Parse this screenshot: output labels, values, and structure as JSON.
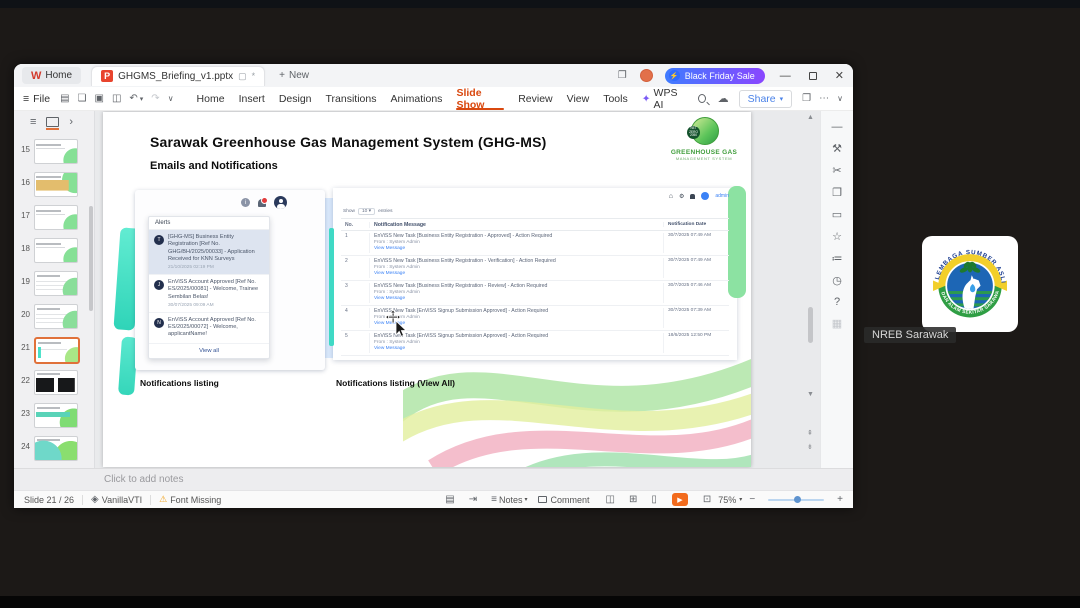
{
  "titlebar": {
    "home_tab": "Home",
    "doc_tab": "GHGMS_Briefing_v1.pptx",
    "doc_modified": "*",
    "new_tab": "New",
    "promo": "Black Friday Sale"
  },
  "menubar": {
    "file": "File",
    "items": [
      "Home",
      "Insert",
      "Design",
      "Transitions",
      "Animations",
      "Slide Show",
      "Review",
      "View",
      "Tools",
      "WPS AI"
    ],
    "share": "Share"
  },
  "icons": {
    "burger": "≡",
    "save": "▤",
    "export": "❏",
    "print": "▣",
    "preview": "◫",
    "undo": "↶",
    "redo": "↷",
    "caret_down": "▾",
    "chevron_down": "∨",
    "sparkle": "✦",
    "cloud": "☁",
    "panel": "❐",
    "ellipsis": "⋯",
    "window_stack": "❐",
    "minimize": "—",
    "close": "✕",
    "lightning": "⚡",
    "plus": "+",
    "chevron_right": "›",
    "scroll_up": "▲",
    "scroll_down": "▼",
    "page_up": "⇞",
    "page_down": "⇟",
    "home": "⌂",
    "gear": "⚙",
    "warning": "⚠",
    "theme": "◈",
    "doc": "▤",
    "goto": "⇥",
    "play": "▶",
    "fit": "⊡",
    "minus": "−",
    "view_normal": "◫",
    "view_sorter": "⊞",
    "view_read": "▯",
    "toolbar_right": [
      "—",
      "⚒",
      "✂",
      "❐",
      "▭",
      "☆",
      "≔",
      "◷",
      "?",
      "▦"
    ]
  },
  "sidebar": {
    "numbers": [
      "15",
      "16",
      "17",
      "18",
      "19",
      "20",
      "21",
      "22",
      "23",
      "24"
    ],
    "selected": "21"
  },
  "slide": {
    "title": "Sarawak Greenhouse Gas Management System (GHG-MS)",
    "subtitle": "Emails and Notifications",
    "logo": {
      "badge": "NET ZERO 2050",
      "line1": "GREENHOUSE GAS",
      "line2": "MANAGEMENT SYSTEM"
    },
    "captions": {
      "left": "Notifications listing",
      "right": "Notifications listing (View All)"
    },
    "alerts": {
      "header": "Alerts",
      "view_all": "View all",
      "items": [
        {
          "initial": "T",
          "text": "[GHG-MS] Business Entity Registration [Ref No. GHG/BH/2025/00033] - Application Received for KNN Surveys",
          "time": "21/10/2025 02:19 PM"
        },
        {
          "initial": "J",
          "text": "EnViSS Account Approved [Ref No. ES/2025/00081] - Welcome, Trainee Sembilan Belas!",
          "time": "30/07/2025 09:09 AM"
        },
        {
          "initial": "N",
          "text": "EnViSS Account Approved [Ref No. ES/2025/00072] - Welcome, applicantName!",
          "time": ""
        }
      ]
    },
    "portal": {
      "user": "admin",
      "show": "Show",
      "page_size": "10",
      "entries": "entries",
      "headers": [
        "No.",
        "Notification Message",
        "Notification Date"
      ],
      "from": "From : System Admin",
      "view_message": "View Message",
      "rows": [
        {
          "no": "1",
          "msg": "EnViSS New Task [Business Entity Registration - Approved] - Action Required",
          "date": "30/7/2025 07:49 AM"
        },
        {
          "no": "2",
          "msg": "EnViSS New Task [Business Entity Registration - Verification] - Action Required",
          "date": "30/7/2025 07:49 AM"
        },
        {
          "no": "3",
          "msg": "EnViSS New Task [Business Entity Registration - Review] - Action Required",
          "date": "30/7/2025 07:46 AM"
        },
        {
          "no": "4",
          "msg": "EnViSS New Task [EnViSS Signup Submission Approved] - Action Required",
          "date": "30/7/2025 07:39 AM"
        },
        {
          "no": "5",
          "msg": "EnViSS New Task [EnViSS Signup Submission Approved] - Action Required",
          "date": "18/6/2025 12:50 PM"
        }
      ]
    }
  },
  "notes": {
    "placeholder": "Click to add notes"
  },
  "statusbar": {
    "slide": "Slide 21 / 26",
    "theme": "VanillaVTI",
    "warning": "Font Missing",
    "notes": "Notes",
    "comment": "Comment",
    "zoom": "75%"
  },
  "participant": {
    "name": "NREB Sarawak",
    "arc_top": "LEMBAGA SUMBER ASLI",
    "arc_bottom": "DAN ALAM SEKITAR SARAWAK"
  },
  "colors": {
    "accent_orange": "#d9480f",
    "promo_blue": "#3f7bff",
    "promo_purple": "#8a46ff",
    "teal": "#3fd9c5",
    "brand_green": "#3f9d3b",
    "link_blue": "#3b82f6",
    "play_orange": "#f26b1d"
  }
}
